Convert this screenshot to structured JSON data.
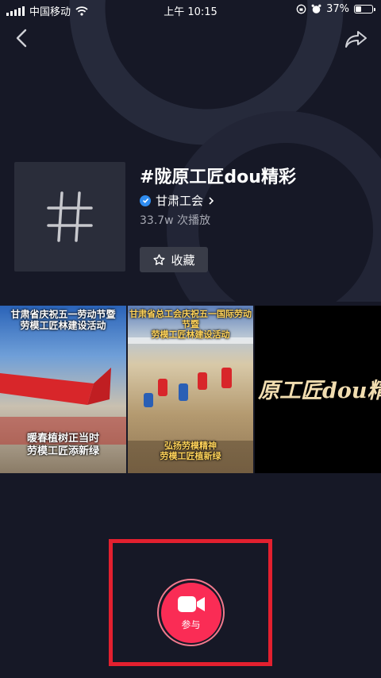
{
  "status_bar": {
    "carrier": "中国移动",
    "time": "上午 10:15",
    "battery_percent": "37%",
    "battery_level": 0.37
  },
  "topic": {
    "title": "#陇原工匠dou精彩",
    "creator": "甘肃工会",
    "plays": "33.7w 次播放",
    "favorite_label": "收藏"
  },
  "videos": [
    {
      "caption_top": "甘肃省庆祝五一劳动节暨\n劳模工匠林建设活动",
      "caption_bottom": "暖春植树正当时\n劳模工匠添新绿"
    },
    {
      "caption_top": "甘肃省总工会庆祝五一国际劳动节暨\n劳模工匠林建设活动",
      "caption_bottom": "弘扬劳模精神\n劳模工匠植新绿"
    },
    {
      "caption_text": "原工匠dou精"
    }
  ],
  "join_button": {
    "label": "参与"
  },
  "colors": {
    "background": "#161826",
    "accent": "#fa2c55",
    "highlight": "#e3202f",
    "verified": "#2f8cf0"
  },
  "icons": {
    "back": "chevron-left-icon",
    "share": "share-arrow-icon",
    "hash": "hash-icon",
    "star": "star-outline-icon",
    "camera": "video-camera-icon"
  }
}
